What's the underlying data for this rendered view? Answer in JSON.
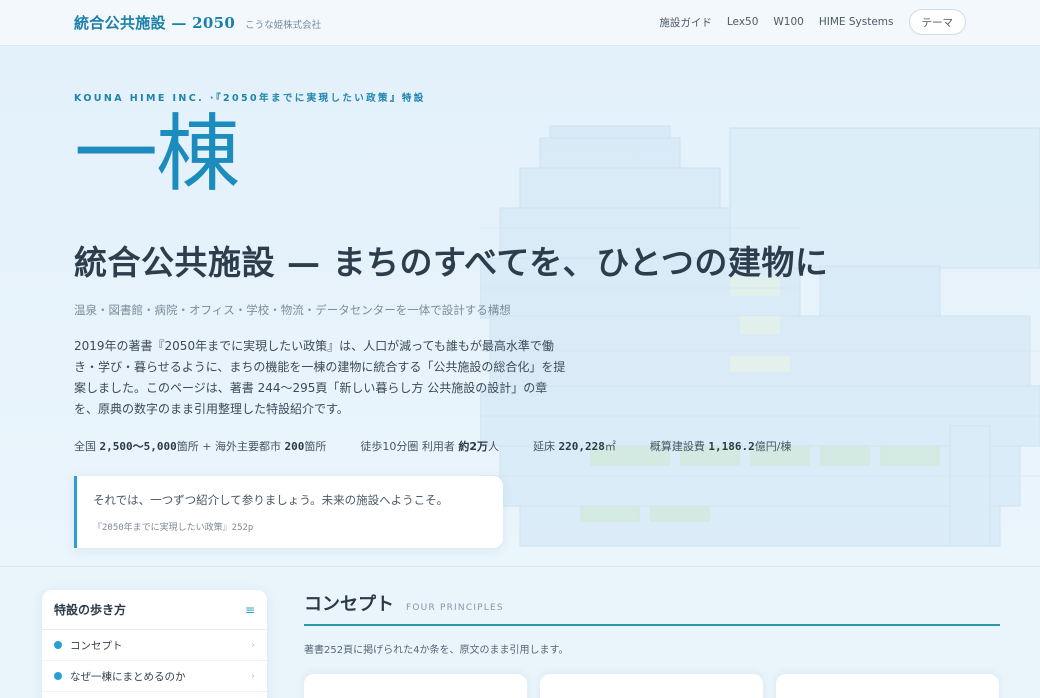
{
  "header": {
    "title": "統合公共施設 — 2050",
    "subtitle": "こうな姫株式会社",
    "nav": [
      "施設ガイド",
      "Lex50",
      "W100",
      "HIME Systems"
    ],
    "theme_button": "テーマ"
  },
  "hero": {
    "kicker": "KOUNA HIME INC. ·『2050年までに実現したい政策』特設",
    "mark": "一棟",
    "headline": "統合公共施設 — まちのすべてを、ひとつの建物に",
    "tagline": "温泉・図書館・病院・オフィス・学校・物流・データセンターを一体で設計する構想",
    "intro": "2019年の著書『2050年までに実現したい政策』は、人口が減っても誰もが最高水準で働き・学び・暮らせるように、まちの機能を一棟の建物に統合する「公共施設の総合化」を提案しました。このページは、著書 244〜295頁「新しい暮らし方 公共施設の設計」の章を、原典の数字のまま引用整理した特設紹介です。",
    "stats": [
      {
        "pre": "全国 ",
        "v1": "2,500〜5,000",
        "mid": "箇所 + 海外主要都市 ",
        "v2": "200",
        "post": "箇所"
      },
      {
        "pre": "徒歩10分圏 利用者 ",
        "v1": "約2万",
        "mid": "人",
        "v2": "",
        "post": ""
      },
      {
        "pre": "延床 ",
        "v1": "220,228",
        "mid": "㎡",
        "v2": "",
        "post": ""
      },
      {
        "pre": "概算建設費 ",
        "v1": "1,186.2",
        "mid": "億円/棟",
        "v2": "",
        "post": ""
      }
    ],
    "quote": {
      "text": "それでは、一つずつ紹介して参りましょう。未来の施設へようこそ。",
      "cite": "『2050年までに実現したい政策』252p"
    }
  },
  "sidebar": {
    "title": "特設の歩き方",
    "menu_icon": "menu-icon",
    "items": [
      {
        "label": "コンセプト"
      },
      {
        "label": "なぜ一棟にまとめるのか"
      }
    ]
  },
  "concept": {
    "title": "コンセプト",
    "en": "FOUR PRINCIPLES",
    "note": "著書252頁に掲げられた4か条を、原文のまま引用します。"
  },
  "colors": {
    "accent": "#2a9fd0",
    "brand": "#1b7fa8",
    "divider": "#2a9aa8"
  }
}
